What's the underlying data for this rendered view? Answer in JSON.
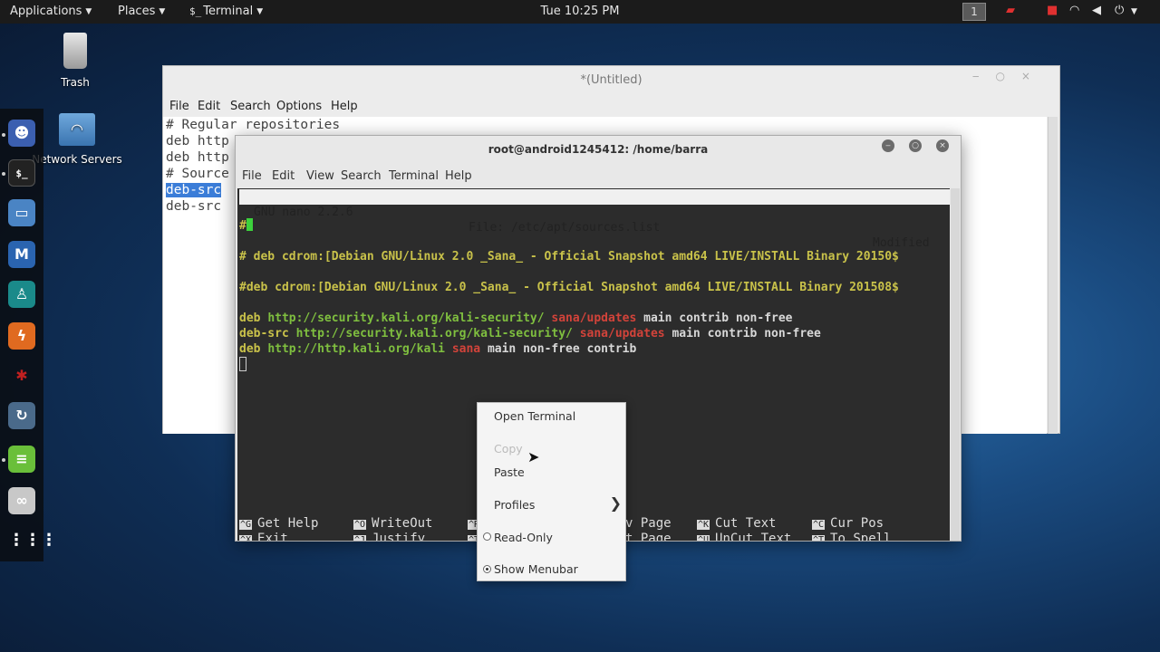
{
  "top_panel": {
    "applications": "Applications",
    "places": "Places",
    "terminal": "Terminal",
    "terminal_icon": "$_",
    "clock": "Tue 10:25 PM",
    "workspace": "1"
  },
  "desktop": {
    "trash": "Trash",
    "network_servers": "Network Servers"
  },
  "gedit": {
    "title": "*(Untitled)",
    "menu": [
      "File",
      "Edit",
      "Search",
      "Options",
      "Help"
    ],
    "lines": [
      "# Regular repositories",
      "deb http",
      "deb http",
      "# Source",
      "deb-src",
      "deb-src"
    ]
  },
  "terminal": {
    "title": "root@android1245412: /home/barra",
    "menu": [
      "File",
      "Edit",
      "View",
      "Search",
      "Terminal",
      "Help"
    ],
    "nano_version": "GNU nano 2.2.6",
    "nano_file": "File: /etc/apt/sources.list",
    "nano_status": "Modified",
    "lines": {
      "hash": "#",
      "cdrom1": "# deb cdrom:[Debian GNU/Linux 2.0 _Sana_ - Official Snapshot amd64 LIVE/INSTALL Binary 20150$",
      "cdrom2": "#deb cdrom:[Debian GNU/Linux 2.0 _Sana_ - Official Snapshot amd64 LIVE/INSTALL Binary 201508$",
      "l1_kw": "deb",
      "l1_url": "http://security.kali.org/kali-security/",
      "l1_dist": "sana/updates",
      "l1_comp": "main contrib non-free",
      "l2_kw": "deb-src",
      "l2_url": "http://security.kali.org/kali-security/",
      "l2_dist": "sana/updates",
      "l2_comp": "main contrib non-free",
      "l3_kw": "deb",
      "l3_url": "http://http.kali.org/kali",
      "l3_dist": "sana",
      "l3_comp": "main non-free contrib"
    },
    "shortcuts": [
      {
        "key": "^G",
        "label": "Get Help"
      },
      {
        "key": "^X",
        "label": "Exit"
      },
      {
        "key": "^O",
        "label": "WriteOut"
      },
      {
        "key": "^J",
        "label": "Justify"
      },
      {
        "key": "^R",
        "label": ""
      },
      {
        "key": "^T",
        "label": ""
      },
      {
        "key": "^Y",
        "label": "v Page"
      },
      {
        "key": "^V",
        "label": "t Page"
      },
      {
        "key": "^K",
        "label": "Cut Text"
      },
      {
        "key": "^U",
        "label": "UnCut Text"
      },
      {
        "key": "^C",
        "label": "Cur Pos"
      },
      {
        "key": "^T",
        "label": "To Spell"
      }
    ]
  },
  "context_menu": {
    "open_terminal": "Open Terminal",
    "copy": "Copy",
    "paste": "Paste",
    "profiles": "Profiles",
    "read_only": "Read-Only",
    "show_menubar": "Show Menubar",
    "read_only_checked": false,
    "show_menubar_checked": true
  },
  "colors": {
    "panel_bg": "#1b1b1b",
    "terminal_bg": "#2c2c2c",
    "selection": "#3b7dd8"
  }
}
